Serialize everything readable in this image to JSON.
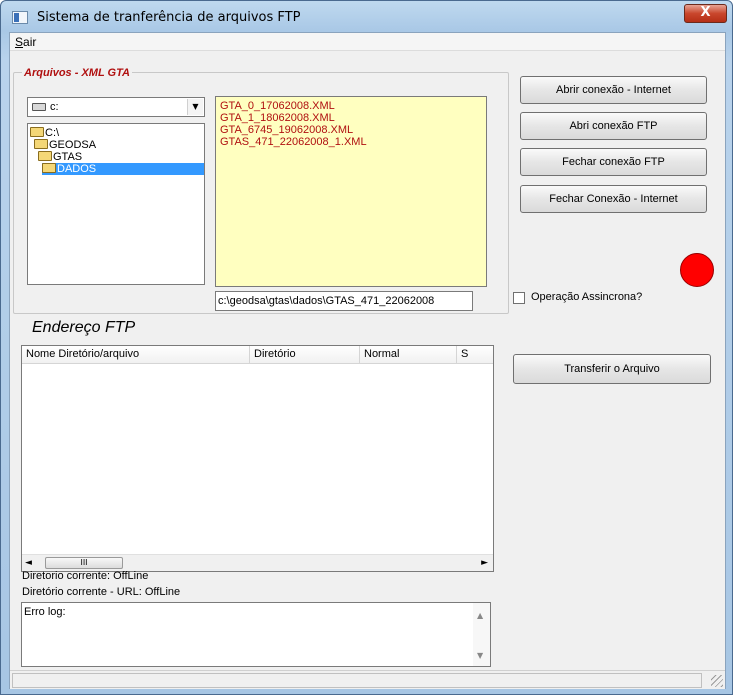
{
  "window": {
    "title": "Sistema de tranferência de arquivos  FTP",
    "close_glyph": "X"
  },
  "menu": {
    "items": [
      "Sair"
    ]
  },
  "arquivos": {
    "legend": "Arquivos - XML GTA",
    "drive": "c:",
    "directories": [
      "C:\\",
      "GEODSA",
      "GTAS",
      "DADOS"
    ],
    "selected_directory": "DADOS",
    "files": [
      "GTA_0_17062008.XML",
      "GTA_1_18062008.XML",
      "GTA_6745_19062008.XML",
      "GTAS_471_22062008_1.XML"
    ],
    "selected_path": "c:\\geodsa\\gtas\\dados\\GTAS_471_22062008"
  },
  "buttons": {
    "abrir_internet": "Abrir conexão  - Internet",
    "abrir_ftp": "Abri conexão FTP",
    "fechar_ftp": "Fechar conexão FTP",
    "fechar_internet": "Fechar Conexão - Internet",
    "transferir": "Transferir o Arquivo"
  },
  "connection_status_color": "#ff0000",
  "options": {
    "assincrona_label": "Operação Assincrona?",
    "assincrona_checked": false
  },
  "ftp": {
    "label": "Endereço FTP",
    "columns": [
      "Nome Diretório/arquivo",
      "Diretório",
      "Normal",
      "S"
    ],
    "rows": []
  },
  "status": {
    "diretorio_corrente": "Diretorio corrente: OffLine",
    "diretorio_corrente_url": "Diretório corrente - URL: OffLine"
  },
  "log": {
    "label": "Erro log:"
  },
  "scrollbar": {
    "thumb_grip": "III"
  }
}
